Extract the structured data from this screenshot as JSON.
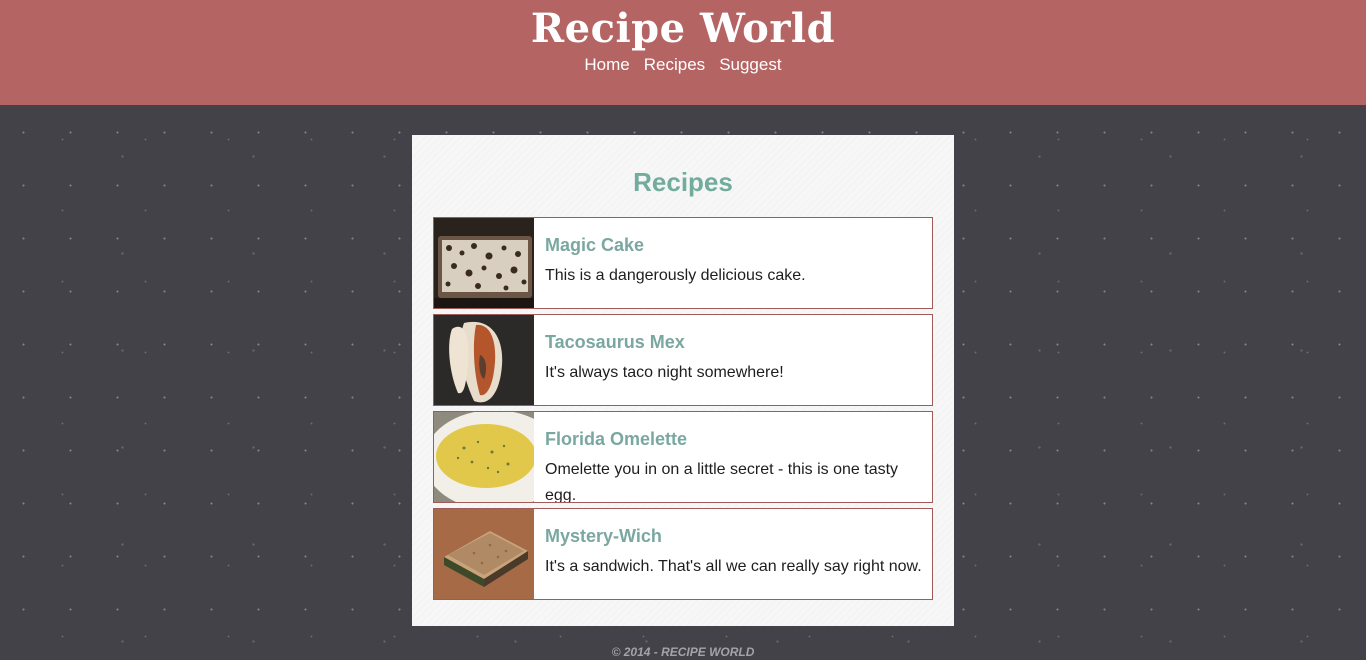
{
  "site": {
    "title": "Recipe World"
  },
  "nav": {
    "items": [
      {
        "label": "Home"
      },
      {
        "label": "Recipes"
      },
      {
        "label": "Suggest"
      }
    ]
  },
  "main": {
    "heading": "Recipes",
    "recipes": [
      {
        "title": "Magic Cake",
        "description": "This is a dangerously delicious cake.",
        "image": "cake-photo"
      },
      {
        "title": "Tacosaurus Mex",
        "description": "It's always taco night somewhere!",
        "image": "taco-photo"
      },
      {
        "title": "Florida Omelette",
        "description": "Omelette you in on a little secret - this is one tasty egg.",
        "image": "omelette-photo"
      },
      {
        "title": "Mystery-Wich",
        "description": "It's a sandwich. That's all we can really say right now.",
        "image": "sandwich-photo"
      }
    ]
  },
  "footer": {
    "text": "© 2014 - RECIPE WORLD"
  },
  "colors": {
    "header_bg": "#b56464",
    "page_bg": "#434249",
    "heading": "#72ac9d",
    "recipe_title": "#7aa7a0",
    "card_border": "#a05a5a"
  }
}
